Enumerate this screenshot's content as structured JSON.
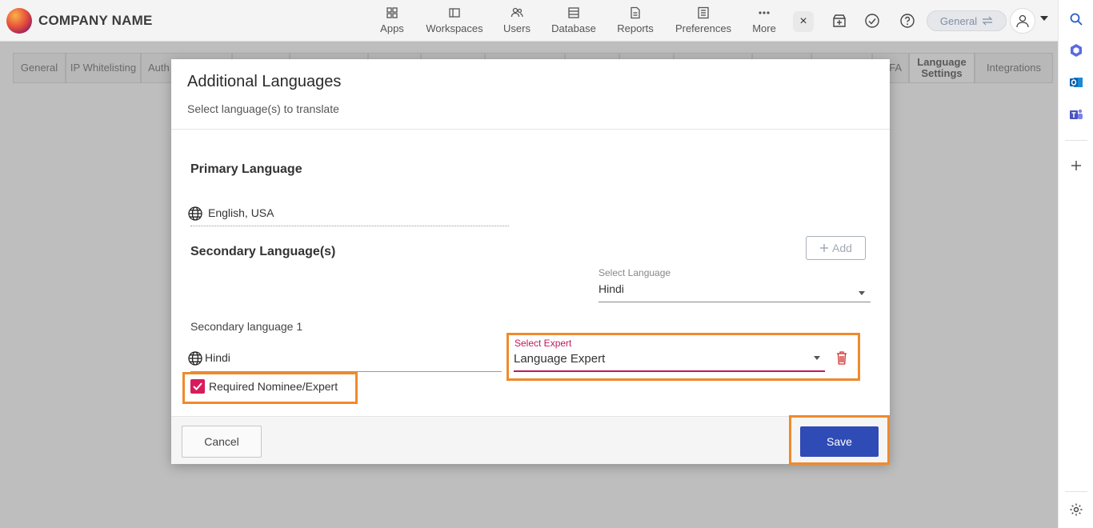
{
  "header": {
    "company": "COMPANY NAME",
    "nav": [
      {
        "label": "Apps",
        "icon": "grid-icon"
      },
      {
        "label": "Workspaces",
        "icon": "workspaces-icon"
      },
      {
        "label": "Users",
        "icon": "users-icon"
      },
      {
        "label": "Database",
        "icon": "database-icon"
      },
      {
        "label": "Reports",
        "icon": "reports-icon"
      },
      {
        "label": "Preferences",
        "icon": "preferences-icon"
      },
      {
        "label": "More",
        "icon": "more-icon"
      }
    ],
    "close_glyph": "×",
    "workspace_pill": "General",
    "colors": {
      "accent": "#2f4bb6",
      "highlight": "#f08a2c",
      "checkbox": "#d81b5c",
      "delete": "#d0312d"
    }
  },
  "tabs": [
    {
      "label": "General"
    },
    {
      "label": "IP Whitelisting"
    },
    {
      "label": "Auth"
    },
    {
      "label": "FA"
    },
    {
      "label": "Language Settings",
      "active": true
    },
    {
      "label": "Integrations"
    }
  ],
  "modal": {
    "title": "Additional Languages",
    "subtitle": "Select language(s) to translate",
    "primary_heading": "Primary Language",
    "primary_value": "English, USA",
    "secondary_heading": "Secondary Language(s)",
    "add_label": "Add",
    "select_language_label": "Select Language",
    "select_language_value": "Hindi",
    "secondary_item_label": "Secondary language 1",
    "secondary_item_value": "Hindi",
    "select_expert_label": "Select Expert",
    "select_expert_value": "Language Expert",
    "required_label": "Required Nominee/Expert",
    "required_checked": true,
    "cancel_label": "Cancel",
    "save_label": "Save"
  }
}
